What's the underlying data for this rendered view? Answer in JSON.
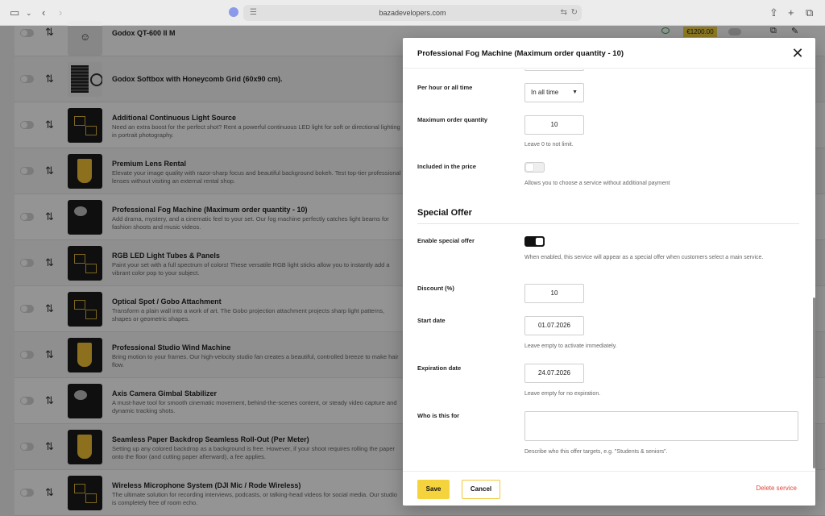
{
  "browser": {
    "url": "bazadevelopers.com"
  },
  "list": {
    "rows": [
      {
        "title": "Godox QT-600 II M",
        "desc": "",
        "thumb": "empty"
      },
      {
        "title": "Godox Softbox with Honeycomb Grid (60x90 cm).",
        "desc": "",
        "thumb": "light"
      },
      {
        "title": "Additional Continuous Light Source",
        "desc": "Need an extra boost for the perfect shot? Rent a powerful continuous LED light for soft or directional lighting in portrait photography.",
        "thumb": "grid"
      },
      {
        "title": "Premium Lens Rental",
        "desc": "Elevate your image quality with razor-sharp focus and beautiful background bokeh. Test top-tier professional lenses without visiting an external rental shop.",
        "thumb": "yellow"
      },
      {
        "title": "Professional Fog Machine (Maximum order quantity - 10)",
        "desc": "Add drama, mystery, and a cinematic feel to your set. Our fog machine perfectly catches light beams for fashion shoots and music videos.",
        "thumb": "fog"
      },
      {
        "title": "RGB LED Light Tubes & Panels",
        "desc": "Paint your set with a full spectrum of colors! These versatile RGB light sticks allow you to instantly add a vibrant color pop to your subject.",
        "thumb": "grid"
      },
      {
        "title": "Optical Spot / Gobo Attachment",
        "desc": "Transform a plain wall into a work of art. The Gobo projection attachment projects sharp light patterns, shapes or geometric shapes.",
        "thumb": "grid"
      },
      {
        "title": "Professional Studio Wind Machine",
        "desc": "Bring motion to your frames. Our high-velocity studio fan creates a beautiful, controlled breeze to make hair flow.",
        "thumb": "yellow"
      },
      {
        "title": "Axis Camera Gimbal Stabilizer",
        "desc": "A must-have tool for smooth cinematic movement, behind-the-scenes content, or steady video capture and dynamic tracking shots.",
        "thumb": "fog"
      },
      {
        "title": "Seamless Paper Backdrop Seamless Roll-Out (Per Meter)",
        "desc": "Setting up any colored backdrop as a background is free. However, if your shoot requires rolling the paper onto the floor (and cutting paper afterward), a fee applies.",
        "thumb": "yellow"
      },
      {
        "title": "Wireless Microphone System (DJI Mic / Rode Wireless)",
        "desc": "The ultimate solution for recording interviews, podcasts, or talking-head videos for social media. Our studio is completely free of room echo.",
        "thumb": "grid"
      }
    ],
    "first_row_price": "€1200.00"
  },
  "panel": {
    "title": "Professional Fog Machine (Maximum order quantity - 10)",
    "per_hour_label": "Per hour or all time",
    "per_hour_value": "In all time",
    "max_qty_label": "Maximum order quantity",
    "max_qty_value": "10",
    "max_qty_hint": "Leave 0 to not limit.",
    "included_label": "Included in the price",
    "included_hint": "Allows you to choose a service without additional payment",
    "special_offer_title": "Special Offer",
    "enable_label": "Enable special offer",
    "enable_hint": "When enabled, this service will appear as a special offer when customers select a main service.",
    "discount_label": "Discount (%)",
    "discount_value": "10",
    "start_label": "Start date",
    "start_value": "01.07.2026",
    "start_hint": "Leave empty to activate immediately.",
    "expiry_label": "Expiration date",
    "expiry_value": "24.07.2026",
    "expiry_hint": "Leave empty for no expiration.",
    "who_label": "Who is this for",
    "who_value": "",
    "who_hint": "Describe who this offer targets, e.g. \"Students & seniors\".",
    "save_label": "Save",
    "cancel_label": "Cancel",
    "delete_label": "Delete service"
  }
}
